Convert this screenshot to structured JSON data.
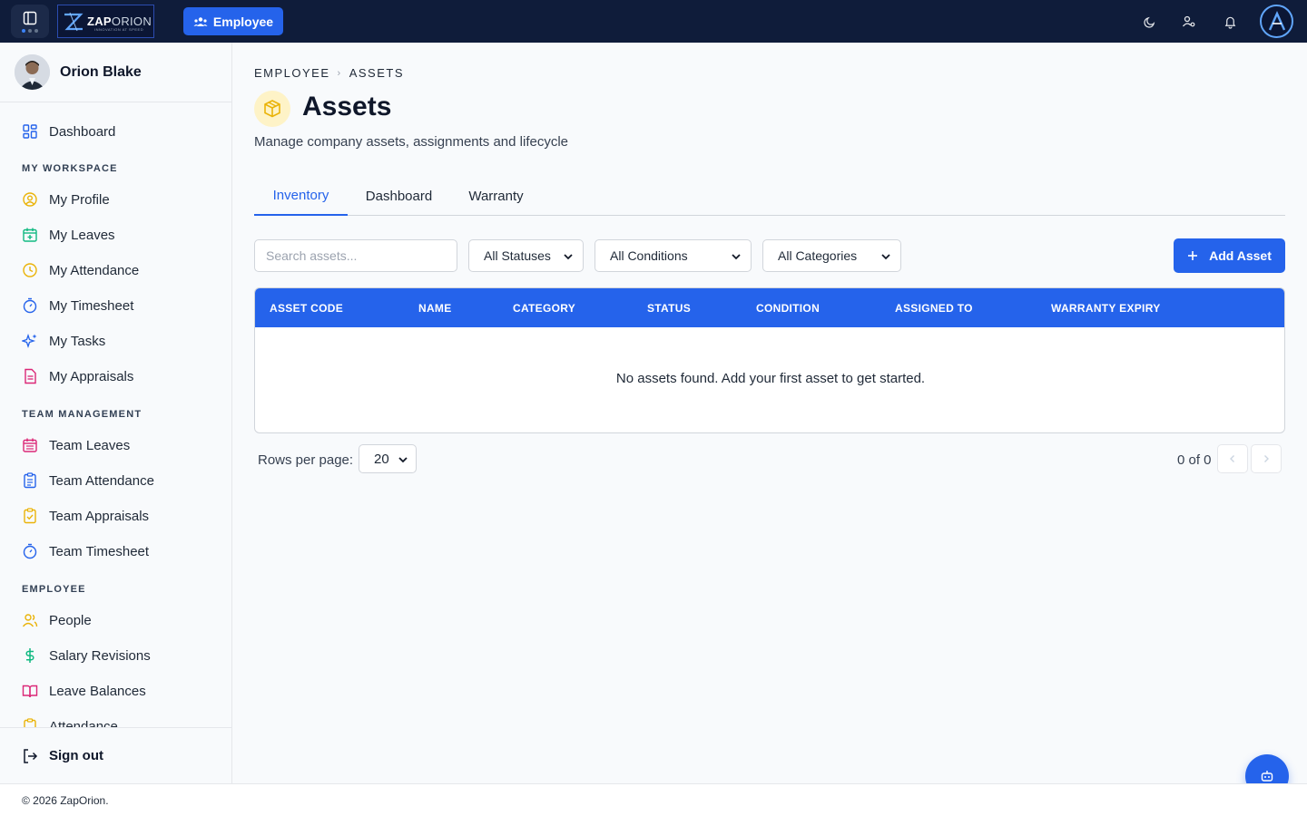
{
  "topbar": {
    "logo": {
      "brand_zap": "ZAP",
      "brand_orion": "ORION",
      "tagline": "INNOVATION AT SPEED"
    },
    "module_chip": "Employee",
    "icons": [
      "moon-icon",
      "users-settings-icon",
      "bell-icon"
    ]
  },
  "sidebar": {
    "user_name": "Orion Blake",
    "dashboard": "Dashboard",
    "sections": {
      "my_workspace": "MY WORKSPACE",
      "team_management": "TEAM MANAGEMENT",
      "employee": "EMPLOYEE"
    },
    "my_workspace_items": [
      "My Profile",
      "My Leaves",
      "My Attendance",
      "My Timesheet",
      "My Tasks",
      "My Appraisals"
    ],
    "team_items": [
      "Team Leaves",
      "Team Attendance",
      "Team Appraisals",
      "Team Timesheet"
    ],
    "employee_items": [
      "People",
      "Salary Revisions",
      "Leave Balances",
      "Attendance"
    ],
    "sign_out": "Sign out"
  },
  "main": {
    "breadcrumb": [
      "EMPLOYEE",
      "ASSETS"
    ],
    "title": "Assets",
    "subtitle": "Manage company assets, assignments and lifecycle",
    "tabs": [
      "Inventory",
      "Dashboard",
      "Warranty"
    ],
    "active_tab": "Inventory",
    "search_placeholder": "Search assets...",
    "filters": {
      "status": "All Statuses",
      "condition": "All Conditions",
      "category": "All Categories"
    },
    "add_button": "Add Asset",
    "table": {
      "columns": [
        "ASSET CODE",
        "NAME",
        "CATEGORY",
        "STATUS",
        "CONDITION",
        "ASSIGNED TO",
        "WARRANTY EXPIRY"
      ],
      "empty_message": "No assets found. Add your first asset to get started."
    },
    "pagination": {
      "rows_label": "Rows per page:",
      "rows_value": "20",
      "range": "0 of 0"
    }
  },
  "footer": {
    "copyright": "© 2026 ZapOrion."
  },
  "colors": {
    "topbar": "#0f1c3a",
    "accent": "#2563eb",
    "background": "#f8fafc"
  }
}
